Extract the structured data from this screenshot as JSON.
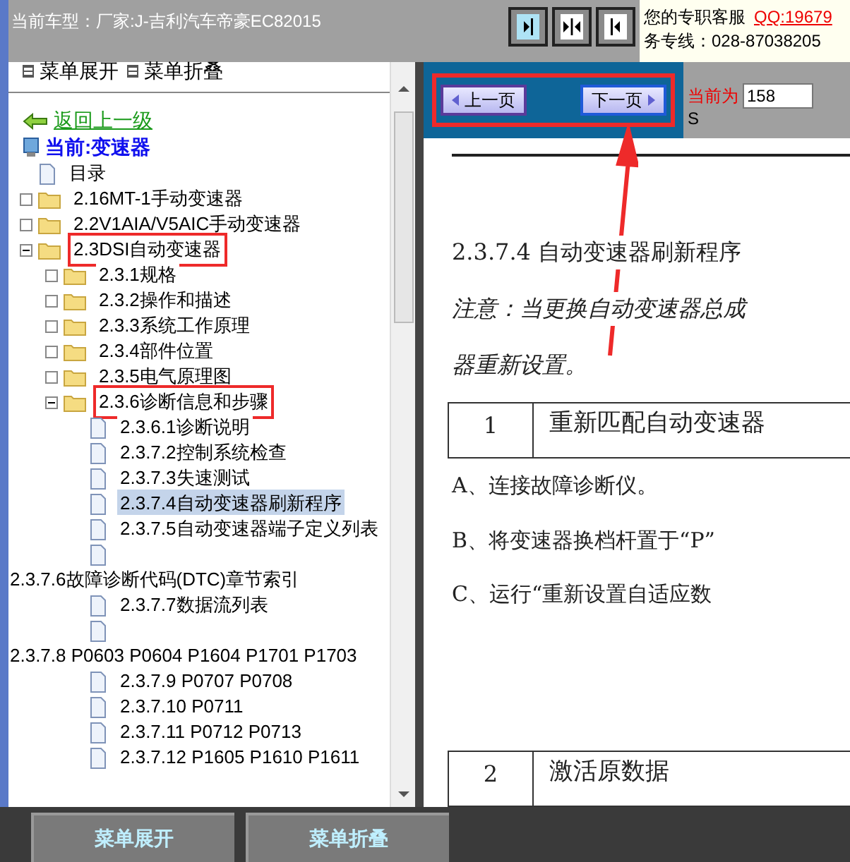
{
  "header": {
    "current_model": "当前车型：厂家:J-吉利汽车帝豪EC82015",
    "service_label": "您的专职客服",
    "qq": "QQ:19679",
    "hotline": "务专线：028-87038205"
  },
  "menu_links": [
    "菜单展开",
    "菜单折叠"
  ],
  "back_link": "返回上一级",
  "current": "当前:变速器",
  "tree": [
    {
      "kind": "page",
      "label": "目录",
      "selected": false
    },
    {
      "kind": "folder",
      "label": "2.16MT-1手动变速器",
      "expanded": false,
      "selected": false
    },
    {
      "kind": "folder",
      "label": "2.2V1AIA/V5AIC手动变速器",
      "expanded": false,
      "selected": false
    },
    {
      "kind": "folder",
      "label": "2.3DSI自动变速器",
      "expanded": true,
      "selected": false,
      "highlighted": true,
      "children": [
        {
          "kind": "folder",
          "label": "2.3.1规格",
          "expanded": false,
          "selected": false
        },
        {
          "kind": "folder",
          "label": "2.3.2操作和描述",
          "expanded": false,
          "selected": false
        },
        {
          "kind": "folder",
          "label": "2.3.3系统工作原理",
          "expanded": false,
          "selected": false
        },
        {
          "kind": "folder",
          "label": "2.3.4部件位置",
          "expanded": false,
          "selected": false
        },
        {
          "kind": "folder",
          "label": "2.3.5电气原理图",
          "expanded": false,
          "selected": false
        },
        {
          "kind": "folder",
          "label": "2.3.6诊断信息和步骤",
          "expanded": true,
          "selected": false,
          "highlighted": true,
          "children": [
            {
              "kind": "page",
              "label": "2.3.6.1诊断说明",
              "selected": false
            },
            {
              "kind": "page",
              "label": "2.3.7.2控制系统检查",
              "selected": false
            },
            {
              "kind": "page",
              "label": "2.3.7.3失速测试",
              "selected": false
            },
            {
              "kind": "page",
              "label": "2.3.7.4自动变速器刷新程序",
              "selected": true
            },
            {
              "kind": "page",
              "label": "2.3.7.5自动变速器端子定义列表",
              "selected": false
            },
            {
              "kind": "page"
            },
            {
              "kind": "text",
              "label": "2.3.7.6故障诊断代码(DTC)章节索引",
              "selected": false
            },
            {
              "kind": "page",
              "label": "2.3.7.7数据流列表",
              "selected": false
            },
            {
              "kind": "page"
            },
            {
              "kind": "text",
              "label": "2.3.7.8 P0603 P0604 P1604 P1701 P1703",
              "selected": false
            },
            {
              "kind": "page",
              "label": "2.3.7.9 P0707 P0708",
              "selected": false
            },
            {
              "kind": "page",
              "label": "2.3.7.10 P0711",
              "selected": false
            },
            {
              "kind": "page",
              "label": "2.3.7.11 P0712 P0713",
              "selected": false
            },
            {
              "kind": "page",
              "label": "2.3.7.12 P1605 P1610 P1611",
              "selected": false
            }
          ]
        }
      ]
    }
  ],
  "pager": {
    "prev": "上一页",
    "next": "下一页",
    "current_label": "当前为",
    "page": "158",
    "unit": "S"
  },
  "document": {
    "heading": "2.3.7.4 自动变速器刷新程序",
    "note": [
      "注意：当更换自动变速器总成",
      "器重新设置。"
    ],
    "steps": [
      {
        "number": "1",
        "title": "重新匹配自动变速器",
        "lines": [
          "A、连接故障诊断仪。",
          "B、将变速器换档杆置于“P”",
          "C、运行“重新设置自适应数"
        ]
      },
      {
        "number": "2",
        "title": "激活原数据"
      }
    ]
  },
  "bottom_buttons": [
    "菜单展开",
    "菜单折叠"
  ]
}
